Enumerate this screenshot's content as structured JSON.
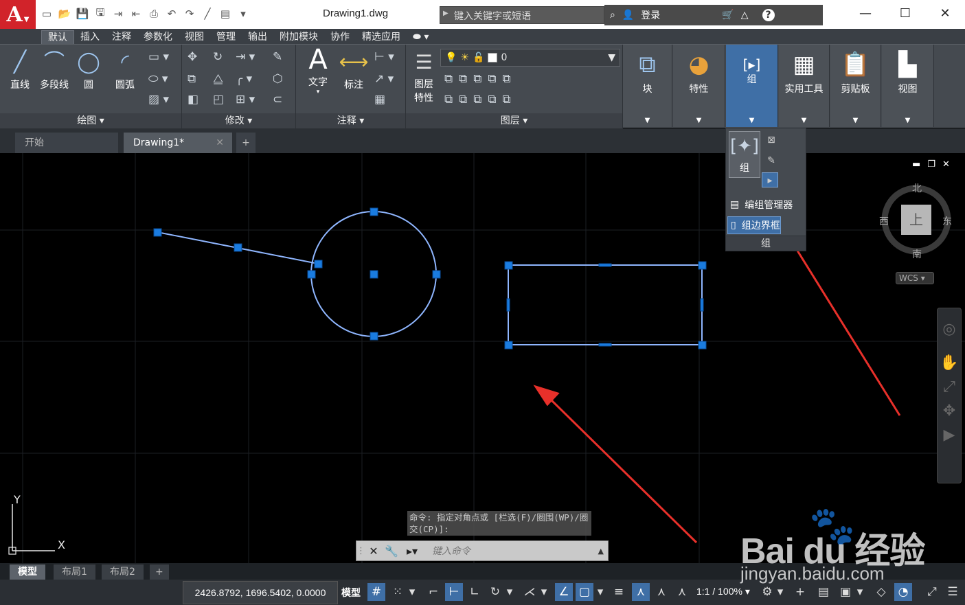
{
  "title_bar": {
    "app_icon": "A",
    "document_title": "Drawing1.dwg",
    "search_placeholder": "键入关键字或短语",
    "login_label": "登录",
    "help_icon": "?"
  },
  "ribbon_tabs": [
    "默认",
    "插入",
    "注释",
    "参数化",
    "视图",
    "管理",
    "输出",
    "附加模块",
    "协作",
    "精选应用"
  ],
  "active_tab": "默认",
  "panels": {
    "draw": {
      "title": "绘图",
      "tools": [
        "直线",
        "多段线",
        "圆",
        "圆弧"
      ]
    },
    "modify": {
      "title": "修改"
    },
    "annotation": {
      "title": "注释",
      "tools": [
        "文字",
        "标注"
      ]
    },
    "layers": {
      "title": "图层",
      "tool": "图层\n特性",
      "current_layer": "0"
    },
    "block": {
      "label": "块"
    },
    "properties": {
      "label": "特性"
    },
    "groups": {
      "label": "组"
    },
    "utilities": {
      "label": "实用工具"
    },
    "clipboard": {
      "label": "剪贴板"
    },
    "view": {
      "label": "视图"
    }
  },
  "group_dropdown": {
    "big_button": "组",
    "rows": [
      "编组管理器",
      "组边界框"
    ],
    "title": "组"
  },
  "file_tabs": [
    {
      "label": "开始",
      "active": false
    },
    {
      "label": "Drawing1*",
      "active": true
    }
  ],
  "viewcube": {
    "north": "北",
    "south": "南",
    "east": "东",
    "west": "西",
    "top": "上",
    "wcs": "WCS"
  },
  "command": {
    "history": "命令: 指定对角点或 [栏选(F)/圈围(WP)/圈交(CP)]:",
    "placeholder": "键入命令"
  },
  "ucs": {
    "x": "X",
    "y": "Y"
  },
  "layout_tabs": [
    {
      "label": "模型",
      "active": true
    },
    {
      "label": "布局1",
      "active": false
    },
    {
      "label": "布局2",
      "active": false
    }
  ],
  "status": {
    "coords": "2426.8792, 1696.5402, 0.0000",
    "model": "模型",
    "scale": "1:1 / 100%"
  },
  "watermark": {
    "brand": "Bai  du 经验",
    "url": "jingyan.baidu.com"
  },
  "colors": {
    "selection": "#1a7ce0",
    "highlight_line": "#8fb6ff",
    "annotation_arrow": "#e8302a"
  }
}
